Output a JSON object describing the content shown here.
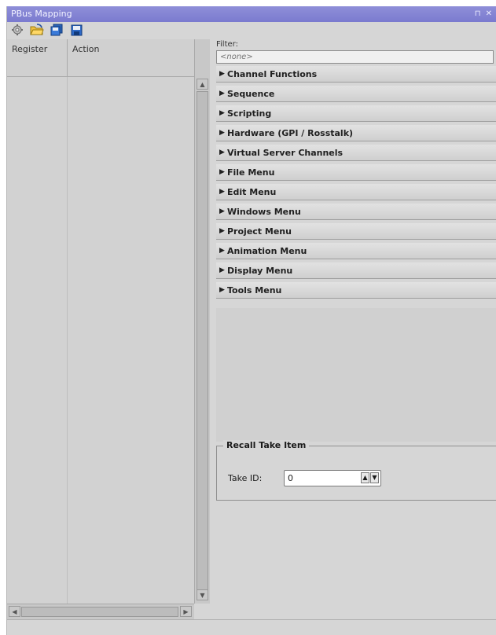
{
  "window": {
    "title": "PBus Mapping",
    "pin_glyph": "⊓",
    "close_glyph": "✕"
  },
  "toolbar": {
    "icons": [
      "gear-icon",
      "open-folder-icon",
      "save-copy-icon",
      "save-icon"
    ]
  },
  "left_list": {
    "columns": [
      "Register",
      "Action"
    ],
    "scroll_up_glyph": "▲",
    "scroll_down_glyph": "▼",
    "scroll_left_glyph": "◀",
    "scroll_right_glyph": "▶"
  },
  "filter": {
    "label": "Filter:",
    "placeholder": "<none>"
  },
  "groups": [
    {
      "label": "Channel Functions"
    },
    {
      "label": "Sequence"
    },
    {
      "label": "Scripting"
    },
    {
      "label": "Hardware (GPI / Rosstalk)"
    },
    {
      "label": "Virtual Server Channels"
    },
    {
      "label": "File Menu"
    },
    {
      "label": "Edit Menu"
    },
    {
      "label": "Windows Menu"
    },
    {
      "label": "Project Menu"
    },
    {
      "label": "Animation Menu"
    },
    {
      "label": "Display Menu"
    },
    {
      "label": "Tools Menu"
    }
  ],
  "recall": {
    "legend": "Recall Take Item",
    "take_label": "Take ID:",
    "take_value": "0",
    "spin_up": "▲",
    "spin_down": "▼"
  },
  "colors": {
    "titlebar": "#7b7bcf",
    "panel": "#d6d6d6"
  }
}
